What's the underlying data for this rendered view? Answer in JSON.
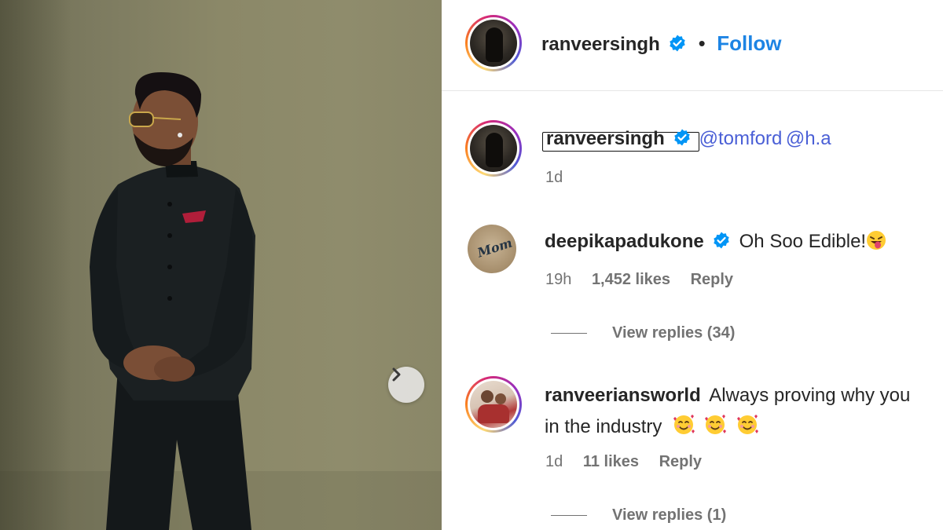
{
  "post": {
    "author": "ranveersingh",
    "follow_label": "Follow",
    "separator": "•",
    "caption_mentions": [
      "@tomford",
      "@h.a"
    ],
    "caption_time": "1d"
  },
  "comments": [
    {
      "user": "deepikapadukone",
      "text": "Oh Soo Edible!",
      "emoji": "face-with-tongue",
      "time": "19h",
      "likes": "1,452 likes",
      "reply_label": "Reply",
      "view_replies": "View replies (34)"
    },
    {
      "user": "ranveeriansworld",
      "text_line1": "Always proving why you",
      "text_line2": "in the industry",
      "emoji": "smiling-face-with-hearts",
      "time": "1d",
      "likes": "11 likes",
      "reply_label": "Reply",
      "view_replies": "View replies (1)"
    }
  ],
  "avatar_text": "Mom",
  "colors": {
    "verified": "#0095f6",
    "follow": "#1d84e4",
    "mention": "#4a5fd6",
    "muted": "#737373"
  },
  "icons": [
    "verified-badge-icon",
    "chevron-right-icon"
  ]
}
